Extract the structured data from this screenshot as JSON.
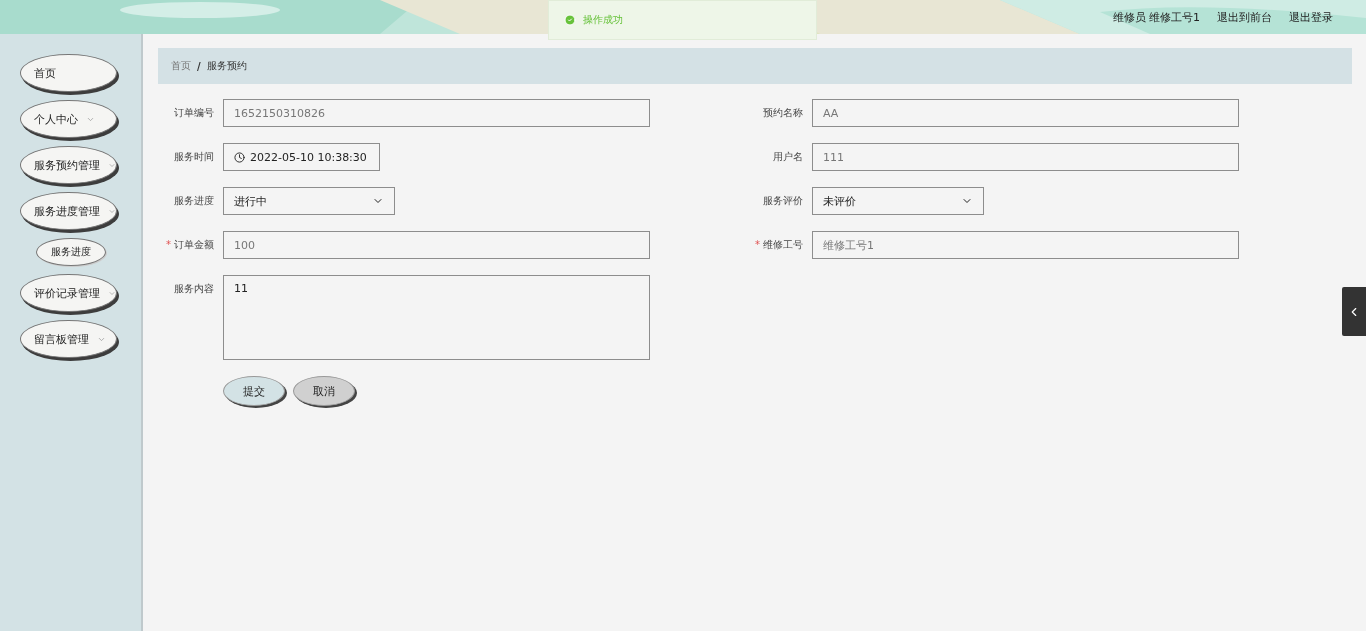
{
  "header": {
    "user_role": "维修员",
    "user_name": "维修工号1",
    "links": [
      "退出到前台",
      "退出登录"
    ]
  },
  "toast": {
    "kind": "success",
    "message": "操作成功"
  },
  "sidebar": {
    "items": [
      {
        "label": "首页",
        "expandable": false
      },
      {
        "label": "个人中心",
        "expandable": true
      },
      {
        "label": "服务预约管理",
        "expandable": true
      },
      {
        "label": "服务进度管理",
        "expandable": true,
        "children": [
          {
            "label": "服务进度"
          }
        ]
      },
      {
        "label": "评价记录管理",
        "expandable": true
      },
      {
        "label": "留言板管理",
        "expandable": true
      }
    ]
  },
  "breadcrumb": {
    "items": [
      "首页",
      "服务预约"
    ],
    "separator": "/"
  },
  "form": {
    "required_mark": "*",
    "rows": [
      [
        {
          "kind": "input",
          "label": "订单编号",
          "value": "1652150310826",
          "required": false,
          "disabled": true
        },
        {
          "kind": "input",
          "label": "预约名称",
          "value": "AA",
          "required": false,
          "disabled": true
        }
      ],
      [
        {
          "kind": "date",
          "label": "服务时间",
          "value": "2022-05-10 10:38:30",
          "required": false,
          "disabled": false
        },
        {
          "kind": "input",
          "label": "用户名",
          "value": "111",
          "required": false,
          "disabled": true
        }
      ],
      [
        {
          "kind": "select",
          "label": "服务进度",
          "value": "进行中",
          "required": false,
          "disabled": false
        },
        {
          "kind": "select",
          "label": "服务评价",
          "value": "未评价",
          "required": false,
          "disabled": false
        }
      ],
      [
        {
          "kind": "input",
          "label": "订单金额",
          "value": "100",
          "required": true,
          "disabled": true
        },
        {
          "kind": "input",
          "label": "维修工号",
          "value": "维修工号1",
          "required": true,
          "disabled": true
        }
      ],
      [
        {
          "kind": "textarea",
          "label": "服务内容",
          "value": "11",
          "required": false,
          "disabled": false
        }
      ]
    ],
    "buttons": [
      {
        "label": "提交",
        "kind": "primary"
      },
      {
        "label": "取消",
        "kind": "cancel"
      }
    ]
  }
}
